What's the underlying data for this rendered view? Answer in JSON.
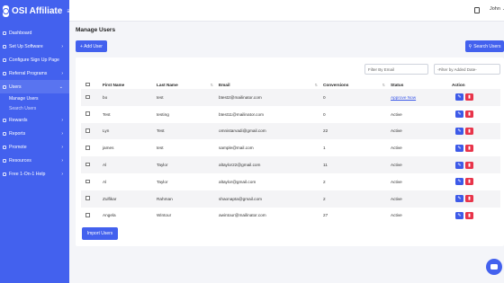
{
  "app": {
    "brand": "OSI Affiliate",
    "menu_icon": "hamburger-icon"
  },
  "sidebar": {
    "items": [
      {
        "label": "Dashboard",
        "icon": "dashboard-icon"
      },
      {
        "label": "Set Up Software",
        "icon": "settings-icon",
        "chevron": "›"
      },
      {
        "label": "Configure Sign Up Page",
        "icon": "edit-icon"
      },
      {
        "label": "Referral Programs",
        "icon": "referral-icon",
        "chevron": "›"
      },
      {
        "label": "Users",
        "icon": "users-icon",
        "chevron": "⌄"
      },
      {
        "label": "Rewards",
        "icon": "gift-icon",
        "chevron": "›"
      },
      {
        "label": "Reports",
        "icon": "reports-icon",
        "chevron": "›"
      },
      {
        "label": "Promote",
        "icon": "megaphone-icon",
        "chevron": "›"
      },
      {
        "label": "Resources",
        "icon": "book-icon",
        "chevron": "›"
      },
      {
        "label": "Free 1-On-1 Help",
        "icon": "help-icon",
        "chevron": "›"
      }
    ],
    "users_sub": [
      {
        "label": "Manage Users"
      },
      {
        "label": "Search Users"
      }
    ]
  },
  "topbar": {
    "user_name": "John",
    "copy_icon": "copy-icon"
  },
  "page": {
    "title": "Manage Users",
    "add_user_label": "+ Add User",
    "search_users_label": "Search Users",
    "filter_email_placeholder": "Filter By Email",
    "filter_date_placeholder": "-Filter by Added Date-",
    "import_label": "Import Users"
  },
  "table": {
    "headers": [
      "First Name",
      "Last Name",
      "Email",
      "Conversions",
      "Status",
      "Action"
    ],
    "rows": [
      {
        "first": "bo",
        "last": "test",
        "email": "btest2@mailinator.com",
        "conversions": "0",
        "status": "Approve Now",
        "status_link": true
      },
      {
        "first": "Test",
        "last": "testing",
        "email": "btest11@mailinator.com",
        "conversions": "0",
        "status": "Active",
        "status_link": false
      },
      {
        "first": "Lyn",
        "last": "Test",
        "email": "omnistarvadi@gmail.com",
        "conversions": "22",
        "status": "Active",
        "status_link": false
      },
      {
        "first": "james",
        "last": "test",
        "email": "sample@mail.com",
        "conversions": "1",
        "status": "Active",
        "status_link": false
      },
      {
        "first": "Al",
        "last": "Taylor",
        "email": "altaylor22@gmail.com",
        "conversions": "11",
        "status": "Active",
        "status_link": false
      },
      {
        "first": "Al",
        "last": "Taylor",
        "email": "altaylor@gmail.com",
        "conversions": "2",
        "status": "Active",
        "status_link": false
      },
      {
        "first": "Zulfikar",
        "last": "Rahman",
        "email": "shaonapta@gmail.com",
        "conversions": "2",
        "status": "Active",
        "status_link": false
      },
      {
        "first": "Angela",
        "last": "Wintour",
        "email": "awintour@mailinator.com",
        "conversions": "27",
        "status": "Active",
        "status_link": false
      }
    ]
  },
  "colors": {
    "primary": "#4361ee",
    "danger": "#e8344a",
    "background": "#f4f5f9"
  }
}
